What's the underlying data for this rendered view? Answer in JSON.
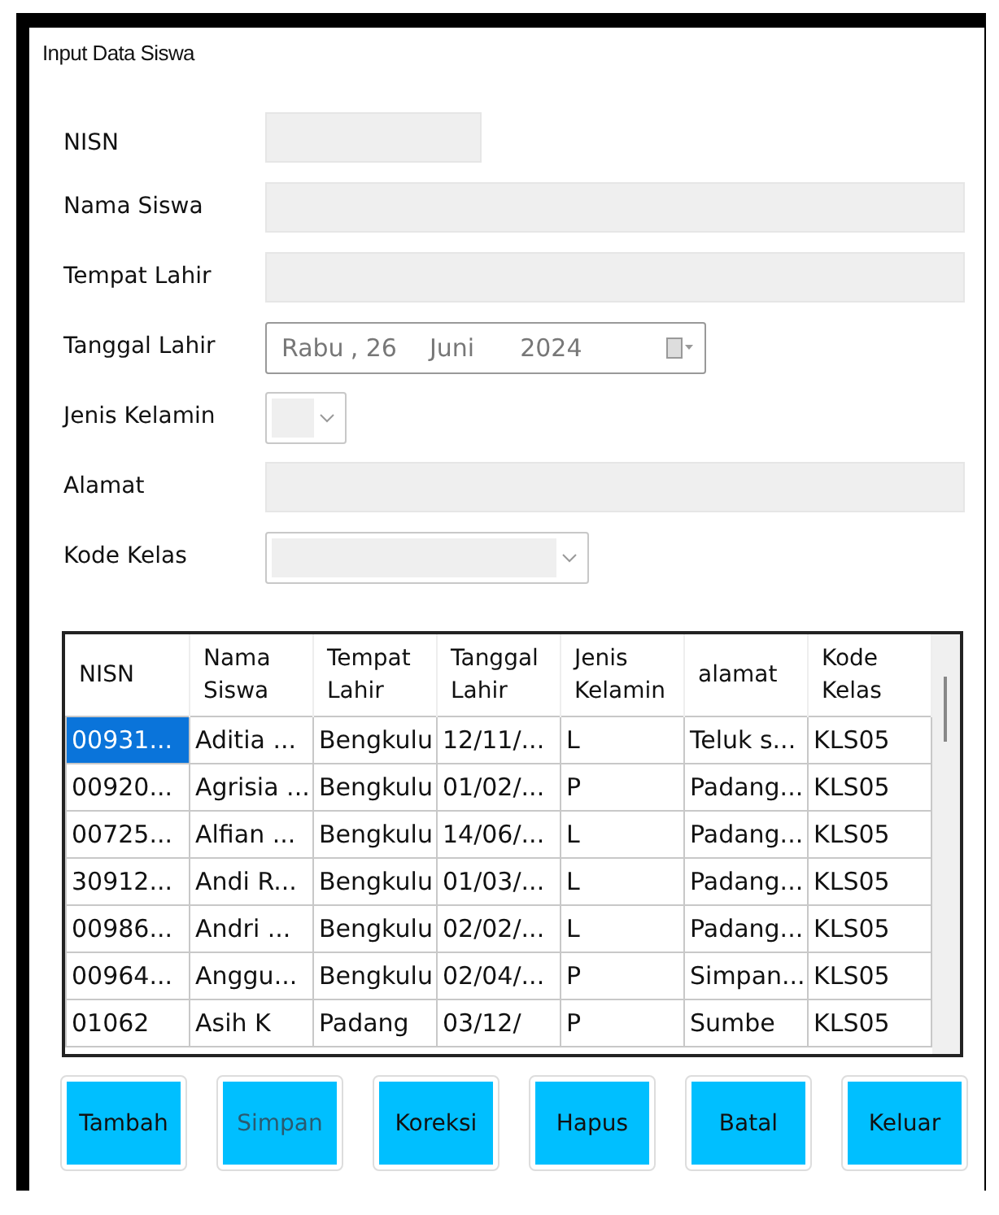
{
  "window": {
    "title": "Input Data Siswa"
  },
  "form": [
    {
      "label": "NISN",
      "kind": "text"
    },
    {
      "label": "Nama Siswa",
      "kind": "text"
    },
    {
      "label": "Tempat Lahir",
      "kind": "text"
    },
    {
      "label": "Tanggal Lahir",
      "kind": "date",
      "parts": [
        "Rabu",
        ", 26",
        "Juni",
        "2024"
      ]
    },
    {
      "label": "Jenis Kelamin",
      "kind": "combo"
    },
    {
      "label": "Alamat",
      "kind": "text"
    },
    {
      "label": "Kode Kelas",
      "kind": "combo"
    }
  ],
  "table": {
    "columns": [
      "NISN",
      "Nama\nSiswa",
      "Tempat\nLahir",
      "Tanggal\nLahir",
      "Jenis\nKelamin",
      "alamat",
      "Kode\nKelas"
    ],
    "rows": [
      {
        "cells": [
          "00931...",
          "Aditia ...",
          "Bengkulu",
          "12/11/...",
          "L",
          "Teluk s...",
          "KLS05"
        ],
        "selected": true
      },
      {
        "cells": [
          "00920...",
          "Agrisia ...",
          "Bengkulu",
          "01/02/...",
          "P",
          "Padang...",
          "KLS05"
        ],
        "selected": false
      },
      {
        "cells": [
          "00725...",
          "Alfian ...",
          "Bengkulu",
          "14/06/...",
          "L",
          "Padang...",
          "KLS05"
        ],
        "selected": false
      },
      {
        "cells": [
          "30912...",
          "Andi R...",
          "Bengkulu",
          "01/03/...",
          "L",
          "Padang...",
          "KLS05"
        ],
        "selected": false
      },
      {
        "cells": [
          "00986...",
          "Andri ...",
          "Bengkulu",
          "02/02/...",
          "L",
          "Padang...",
          "KLS05"
        ],
        "selected": false
      },
      {
        "cells": [
          "00964...",
          "Anggu...",
          "Bengkulu",
          "02/04/...",
          "P",
          "Simpan...",
          "KLS05"
        ],
        "selected": false
      },
      {
        "cells": [
          "01062",
          "Asih K",
          "Padang",
          "03/12/",
          "P",
          "Sumbe",
          "KLS05"
        ],
        "selected": false
      }
    ]
  },
  "buttons": [
    {
      "label": "Tambah",
      "disabled": false
    },
    {
      "label": "Simpan",
      "disabled": true
    },
    {
      "label": "Koreksi",
      "disabled": false
    },
    {
      "label": "Hapus",
      "disabled": false
    },
    {
      "label": "Batal",
      "disabled": false
    },
    {
      "label": "Keluar",
      "disabled": false
    }
  ]
}
